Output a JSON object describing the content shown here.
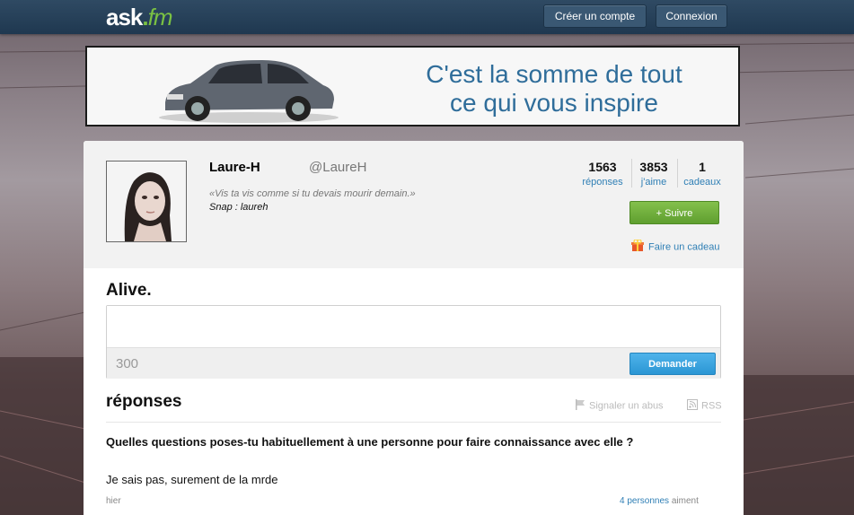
{
  "header": {
    "logo_main": "ask",
    "logo_dot": ".",
    "logo_suffix": "fm",
    "signup_label": "Créer un compte",
    "login_label": "Connexion"
  },
  "banner": {
    "line1": "C'est la somme de tout",
    "line2": "ce qui vous inspire"
  },
  "profile": {
    "name": "Laure-H",
    "username": "@LaureH",
    "quote": "«Vis ta vis comme si tu devais mourir demain.»",
    "snap": "Snap : laureh",
    "stats": [
      {
        "value": "1563",
        "label": "réponses"
      },
      {
        "value": "3853",
        "label": "j'aime"
      },
      {
        "value": "1",
        "label": "cadeaux"
      }
    ],
    "follow_label": "+ Suivre",
    "gift_label": "Faire un cadeau"
  },
  "ask": {
    "title": "Alive.",
    "input_value": "",
    "counter": "300",
    "submit_label": "Demander"
  },
  "answers": {
    "title": "réponses",
    "report_label": "Signaler un abus",
    "rss_label": "RSS",
    "items": [
      {
        "question": "Quelles questions poses-tu habituellement à une personne pour faire connaissance avec elle ?",
        "answer": "Je sais pas, surement de la mrde",
        "time": "hier",
        "likes_link": "4 personnes",
        "likes_suffix": "aiment"
      }
    ]
  },
  "colors": {
    "topbar": "#1f3850",
    "accent_green": "#7ac143",
    "link_blue": "#2f7fb5",
    "submit_blue": "#2b96d4"
  }
}
